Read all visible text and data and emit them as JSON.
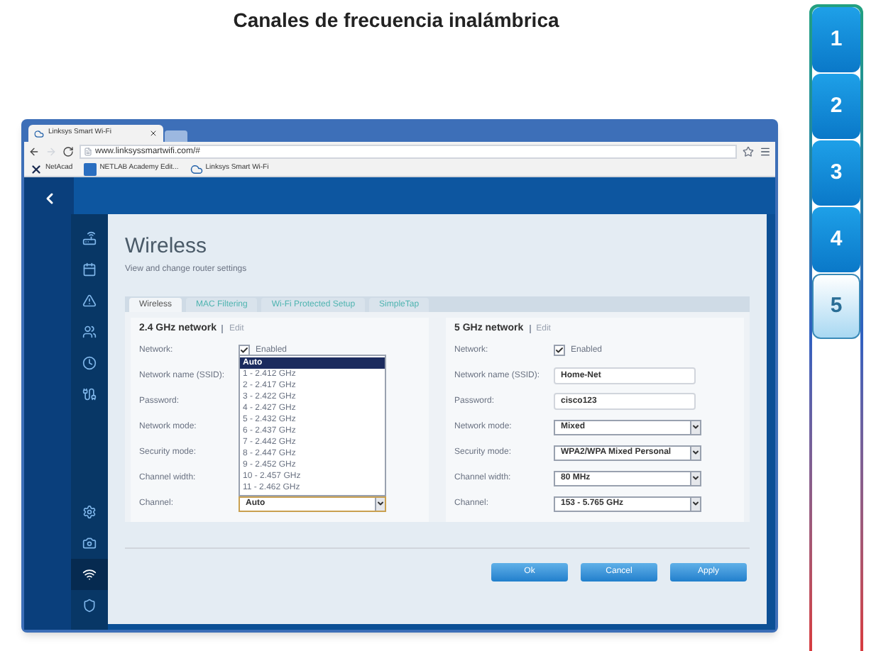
{
  "title": "Canales de frecuencia inalámbrica",
  "browser": {
    "tab_title": "Linksys Smart Wi-Fi",
    "url": "www.linksyssmartwifi.com/#",
    "bookmarks": [
      {
        "label": "NetAcad",
        "kind": "x"
      },
      {
        "label": "NETLAB Academy Edit...",
        "kind": "n"
      },
      {
        "label": "Linksys Smart Wi-Fi",
        "kind": "cloud"
      }
    ]
  },
  "panel": {
    "heading": "Wireless",
    "subtitle": "View and change router settings",
    "tabs": [
      {
        "label": "Wireless",
        "selected": true
      },
      {
        "label": "MAC Filtering",
        "selected": false
      },
      {
        "label": "Wi-Fi Protected Setup",
        "selected": false
      },
      {
        "label": "SimpleTap",
        "selected": false
      }
    ],
    "networks": [
      {
        "heading": "2.4 GHz network",
        "edit": "Edit",
        "rows": [
          {
            "label": "Network:",
            "kind": "checkbox",
            "value": "Enabled",
            "checked": true
          },
          {
            "label": "Network name (SSID):",
            "kind": "covered"
          },
          {
            "label": "Password:",
            "kind": "covered"
          },
          {
            "label": "Network mode:",
            "kind": "covered"
          },
          {
            "label": "Security mode:",
            "kind": "covered"
          },
          {
            "label": "Channel width:",
            "kind": "covered"
          },
          {
            "label": "Channel:",
            "kind": "select",
            "value": "Auto",
            "expanded": true,
            "options": [
              {
                "label": "Auto",
                "selected": true
              },
              {
                "label": "1 - 2.412 GHz",
                "selected": false
              },
              {
                "label": "2 - 2.417 GHz",
                "selected": false
              },
              {
                "label": "3 - 2.422 GHz",
                "selected": false
              },
              {
                "label": "4 - 2.427 GHz",
                "selected": false
              },
              {
                "label": "5 - 2.432 GHz",
                "selected": false
              },
              {
                "label": "6 - 2.437 GHz",
                "selected": false
              },
              {
                "label": "7 - 2.442 GHz",
                "selected": false
              },
              {
                "label": "8 - 2.447 GHz",
                "selected": false
              },
              {
                "label": "9 - 2.452 GHz",
                "selected": false
              },
              {
                "label": "10 - 2.457 GHz",
                "selected": false
              },
              {
                "label": "11 - 2.462 GHz",
                "selected": false
              }
            ]
          }
        ]
      },
      {
        "heading": "5 GHz network",
        "edit": "Edit",
        "rows": [
          {
            "label": "Network:",
            "kind": "checkbox",
            "value": "Enabled",
            "checked": true
          },
          {
            "label": "Network name (SSID):",
            "kind": "text",
            "value": "Home-Net"
          },
          {
            "label": "Password:",
            "kind": "text",
            "value": "cisco123"
          },
          {
            "label": "Network mode:",
            "kind": "select",
            "value": "Mixed",
            "expanded": false
          },
          {
            "label": "Security mode:",
            "kind": "select",
            "value": "WPA2/WPA Mixed Personal",
            "expanded": false
          },
          {
            "label": "Channel width:",
            "kind": "select",
            "value": "80 MHz",
            "expanded": false
          },
          {
            "label": "Channel:",
            "kind": "select",
            "value": "153 - 5.765 GHz",
            "expanded": false
          }
        ]
      }
    ],
    "buttons": [
      "Ok",
      "Cancel",
      "Apply"
    ]
  },
  "steps": [
    {
      "label": "1",
      "selected": false
    },
    {
      "label": "2",
      "selected": false
    },
    {
      "label": "3",
      "selected": false
    },
    {
      "label": "4",
      "selected": false
    },
    {
      "label": "5",
      "selected": true
    }
  ]
}
